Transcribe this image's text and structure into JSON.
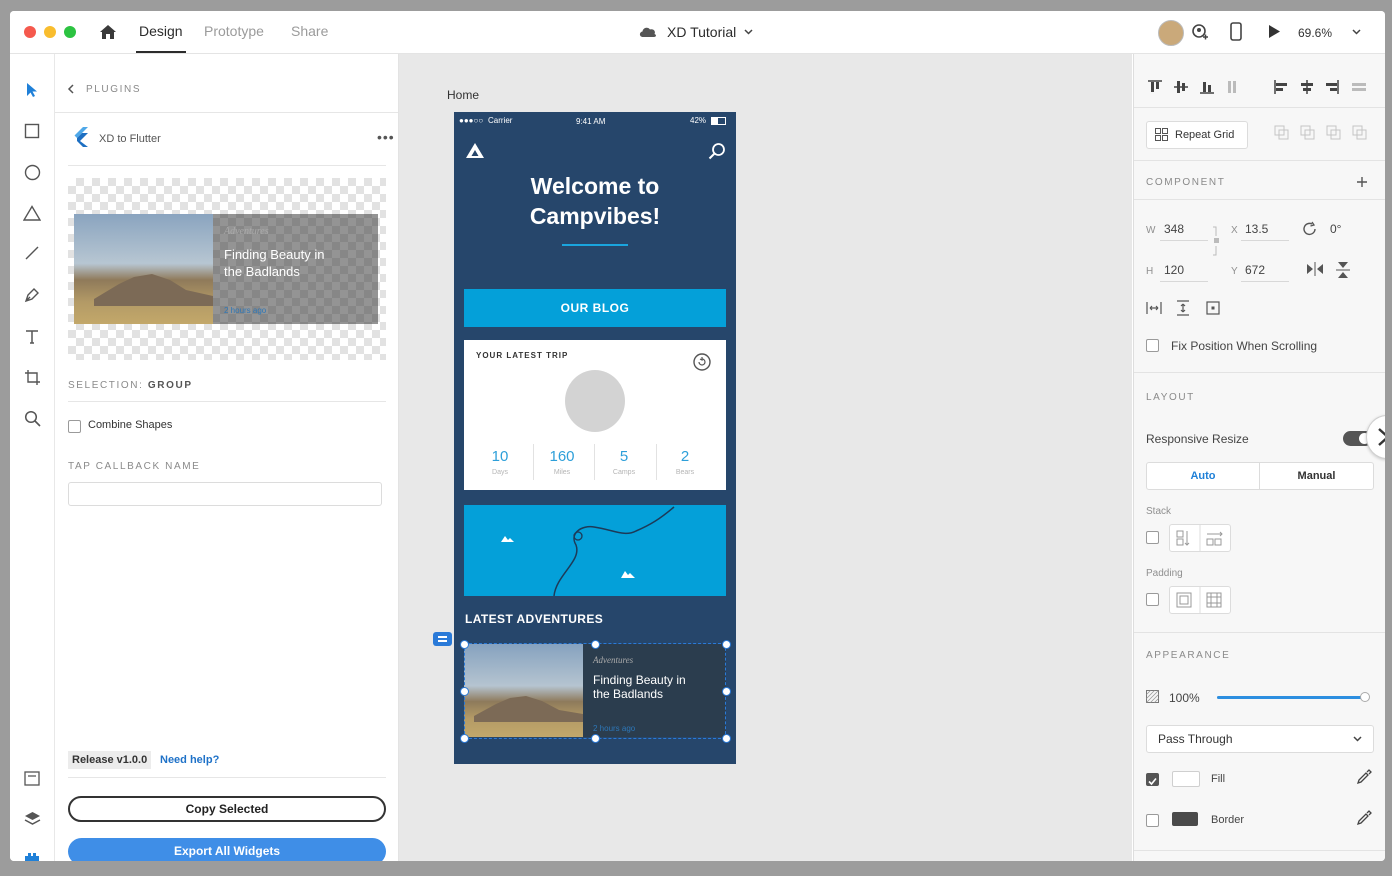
{
  "titlebar": {
    "tabs": [
      "Design",
      "Prototype",
      "Share"
    ],
    "active_tab": "Design",
    "document_title": "XD Tutorial",
    "zoom": "69.6%"
  },
  "plugin": {
    "back_label": "PLUGINS",
    "name": "XD to Flutter",
    "preview": {
      "category": "Adventures",
      "title_line1": "Finding Beauty in",
      "title_line2": "the Badlands",
      "time": "2 hours ago"
    },
    "selection_label": "SELECTION:",
    "selection_value": "GROUP",
    "combine_shapes_label": "Combine Shapes",
    "tap_callback_label": "TAP CALLBACK NAME",
    "tap_callback_value": "",
    "release_label": "Release v1.0.0",
    "help_link": "Need help?",
    "copy_button": "Copy Selected",
    "export_button": "Export All Widgets"
  },
  "canvas": {
    "artboard_name": "Home",
    "status": {
      "carrier": "Carrier",
      "time": "9:41 AM",
      "battery": "42%"
    },
    "welcome_line1": "Welcome to",
    "welcome_line2": "Campvibes!",
    "blog_button": "OUR BLOG",
    "trip_card": {
      "title": "YOUR LATEST TRIP",
      "stats": [
        {
          "value": "10",
          "label": "Days"
        },
        {
          "value": "160",
          "label": "Miles"
        },
        {
          "value": "5",
          "label": "Camps"
        },
        {
          "value": "2",
          "label": "Bears"
        }
      ]
    },
    "latest_title": "LATEST ADVENTURES",
    "adventure_card": {
      "category": "Adventures",
      "title_line1": "Finding Beauty in",
      "title_line2": "the Badlands",
      "time": "2 hours ago"
    }
  },
  "properties": {
    "repeat_grid": "Repeat Grid",
    "component_label": "COMPONENT",
    "w_label": "W",
    "w_value": "348",
    "h_label": "H",
    "h_value": "120",
    "x_label": "X",
    "x_value": "13.5",
    "y_label": "Y",
    "y_value": "672",
    "rotation_value": "0°",
    "fix_position_label": "Fix Position When Scrolling",
    "layout_label": "LAYOUT",
    "responsive_resize_label": "Responsive Resize",
    "auto_label": "Auto",
    "manual_label": "Manual",
    "stack_label": "Stack",
    "padding_label": "Padding",
    "appearance_label": "APPEARANCE",
    "opacity_value": "100%",
    "opacity_fraction": 1.0,
    "blend_mode": "Pass Through",
    "fill_label": "Fill",
    "border_label": "Border"
  },
  "colors": {
    "accent_blue": "#2d9fd9",
    "artboard_navy": "#26466b",
    "blog_button": "#04a0d9",
    "export_button": "#3f8ee7"
  }
}
